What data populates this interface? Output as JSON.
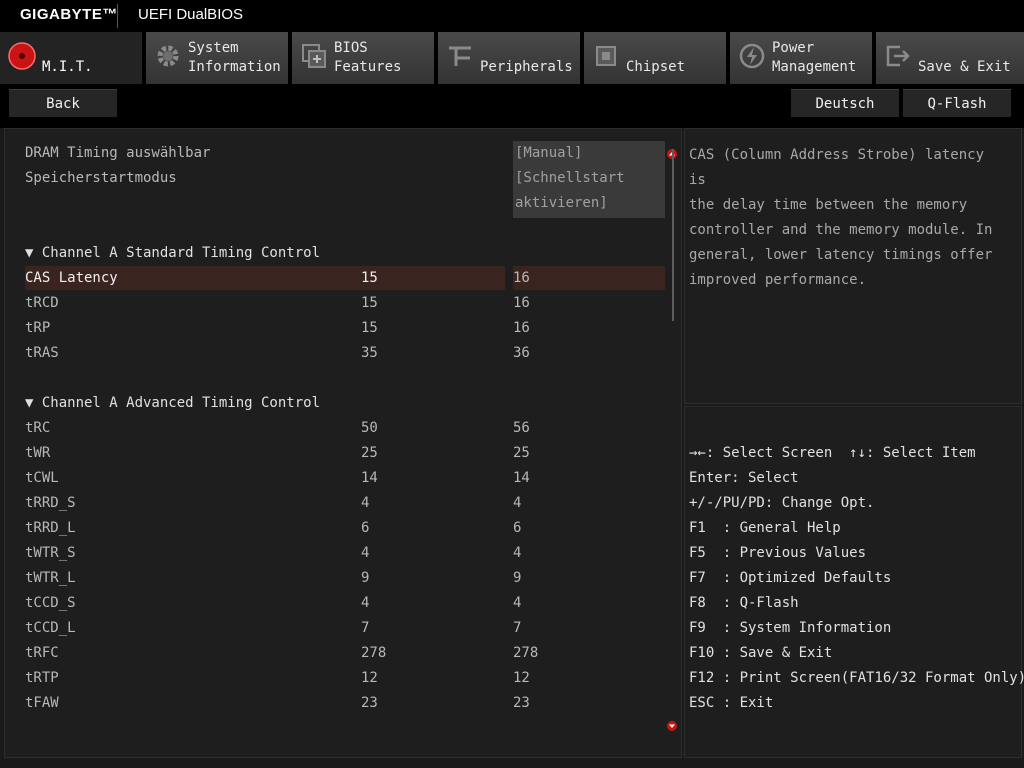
{
  "header": {
    "brand": "GIGABYTE™",
    "app_title": "UEFI DualBIOS"
  },
  "tabs": [
    {
      "label": "M.I.T.",
      "icon": "mit-icon",
      "active": true
    },
    {
      "label": "System\nInformation",
      "icon": "gear-icon"
    },
    {
      "label": "BIOS\nFeatures",
      "icon": "bios-chip-icon"
    },
    {
      "label": "Peripherals",
      "icon": "peripherals-icon"
    },
    {
      "label": "Chipset",
      "icon": "chipset-icon"
    },
    {
      "label": "Power\nManagement",
      "icon": "power-icon"
    },
    {
      "label": "Save & Exit",
      "icon": "exit-icon"
    }
  ],
  "toolbar": {
    "back": "Back",
    "language": "Deutsch",
    "qflash": "Q-Flash"
  },
  "settings": {
    "dram_timing": {
      "label": "DRAM Timing auswählbar",
      "value": "[Manual]"
    },
    "memory_start": {
      "label": "Speicherstartmodus",
      "value_line1": "[Schnellstart",
      "value_line2": "aktivieren]"
    }
  },
  "sections": {
    "standard": "Channel A Standard Timing Control",
    "advanced": "Channel A Advanced Timing Control"
  },
  "standard_rows": [
    {
      "label": "CAS Latency",
      "current": "15",
      "value": "16"
    },
    {
      "label": "tRCD",
      "current": "15",
      "value": "16"
    },
    {
      "label": "tRP",
      "current": "15",
      "value": "16"
    },
    {
      "label": "tRAS",
      "current": "35",
      "value": "36"
    }
  ],
  "advanced_rows": [
    {
      "label": "tRC",
      "current": "50",
      "value": "56"
    },
    {
      "label": "tWR",
      "current": "25",
      "value": "25"
    },
    {
      "label": "tCWL",
      "current": "14",
      "value": "14"
    },
    {
      "label": "tRRD_S",
      "current": "4",
      "value": "4"
    },
    {
      "label": "tRRD_L",
      "current": "6",
      "value": "6"
    },
    {
      "label": "tWTR_S",
      "current": "4",
      "value": "4"
    },
    {
      "label": "tWTR_L",
      "current": "9",
      "value": "9"
    },
    {
      "label": "tCCD_S",
      "current": "4",
      "value": "4"
    },
    {
      "label": "tCCD_L",
      "current": "7",
      "value": "7"
    },
    {
      "label": "tRFC",
      "current": "278",
      "value": "278"
    },
    {
      "label": "tRTP",
      "current": "12",
      "value": "12"
    },
    {
      "label": "tFAW",
      "current": "23",
      "value": "23"
    }
  ],
  "help": {
    "lines": [
      "CAS (Column Address Strobe) latency is",
      "the delay time between the memory",
      "controller and the memory module. In",
      "general, lower latency timings offer",
      "improved performance."
    ]
  },
  "keys": [
    "→←: Select Screen  ↑↓: Select Item",
    "Enter: Select",
    "+/-/PU/PD: Change Opt.",
    "F1  : General Help",
    "F5  : Previous Values",
    "F7  : Optimized Defaults",
    "F8  : Q-Flash",
    "F9  : System Information",
    "F10 : Save & Exit",
    "F12 : Print Screen(FAT16/32 Format Only)",
    "ESC : Exit"
  ],
  "colors": {
    "accent": "#c81414",
    "selected_row": "#3a2420",
    "background": "#1a1a1a"
  }
}
